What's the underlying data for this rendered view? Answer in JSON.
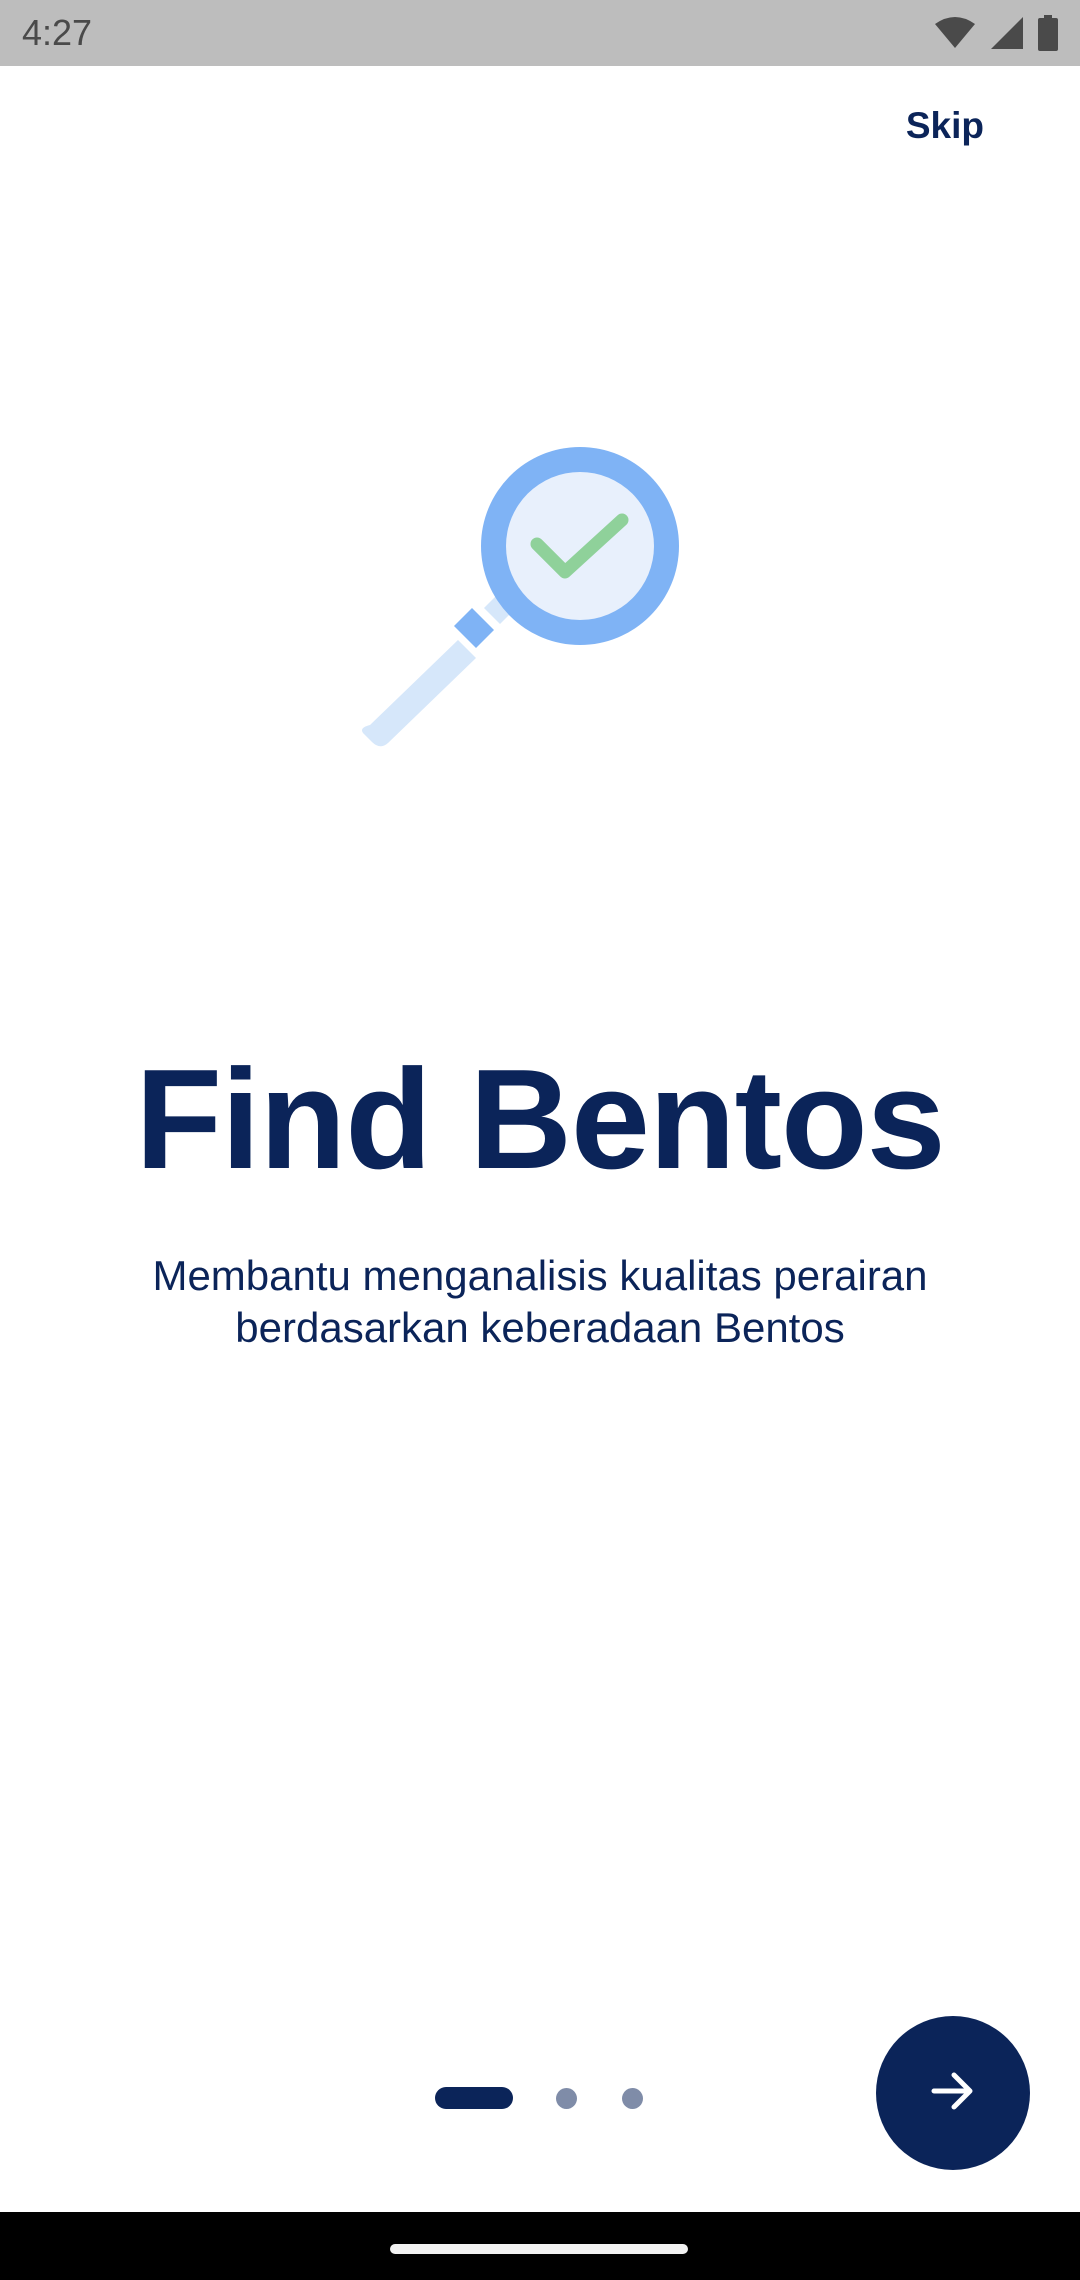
{
  "status_bar": {
    "time": "4:27",
    "icons": [
      "wifi-icon",
      "signal-icon",
      "battery-icon"
    ]
  },
  "onboarding": {
    "skip_label": "Skip",
    "illustration": "magnifier-check-icon",
    "title": "Find Bentos",
    "subtitle_line1": "Membantu menganalisis kualitas perairan",
    "subtitle_line2": "berdasarkan keberadaan Bentos",
    "page_indicator": {
      "current_page": 1,
      "total_pages": 3
    },
    "next_button_icon": "arrow-right-icon"
  },
  "colors": {
    "primary": "#0b2459",
    "indicator_inactive": "#7f8ca8",
    "magnifier_ring": "#7fb3f5",
    "magnifier_glass": "#e8f0fc",
    "handle": "#d6e7fa",
    "check": "#8fd19a"
  }
}
